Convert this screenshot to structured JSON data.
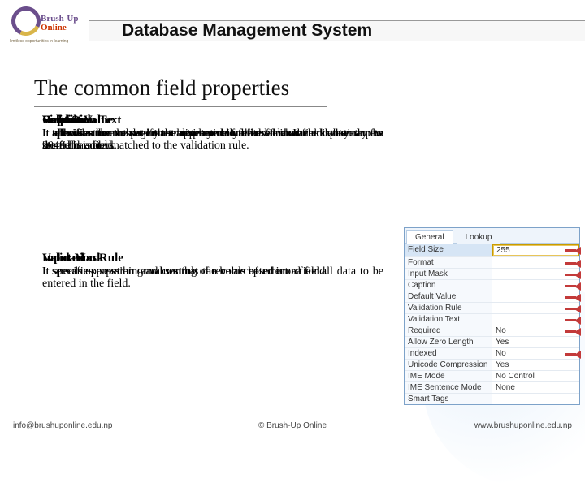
{
  "brand": {
    "name_a": "Brush",
    "name_hy": "-",
    "name_b": "Up",
    "sub": "Online",
    "tag": "limitless opportunities in learning"
  },
  "title": "Database Management System",
  "subtitle": "The common field properties",
  "group1": [
    {
      "h": "Field Size",
      "b": "It allows a user to set the maximum number of characters that can be stored in a field."
    },
    {
      "h": "Caption",
      "b": "It allows a user to set an alternate name for the field. It can contain up to 2048 characters."
    },
    {
      "h": "Validation Text",
      "b": "It specifies the message to be displayed to the user when the data entry for the field is not matched to the validation rule."
    },
    {
      "h": "Format",
      "b": "It allows a user to specify the appearance of the value when displayed."
    },
    {
      "h": "Default Value",
      "b": "It specifies the value that is automatically entered in a field when a new record is added."
    },
    {
      "h": "Required",
      "b": "It tells whether the data must be entered in a field or not."
    }
  ],
  "group2": [
    {
      "h": "Input Mask",
      "b": "It specifies a pattern and controls the value of a record for all data to be entered in the field."
    },
    {
      "h": "Validation Rule",
      "b": "It sets an expression or values that can be accepted into a field."
    },
    {
      "h": "Indexed",
      "b": "It speeds up searching and sorting of records based on a field."
    }
  ],
  "panel": {
    "tab_active": "General",
    "tab_inactive": "Lookup",
    "arrow_rows": [
      "Field Size",
      "Format",
      "Input Mask",
      "Caption",
      "Default Value",
      "Validation Rule",
      "Validation Text",
      "Required",
      "Indexed"
    ],
    "rows": [
      {
        "k": "Field Size",
        "v": "255"
      },
      {
        "k": "Format",
        "v": ""
      },
      {
        "k": "Input Mask",
        "v": ""
      },
      {
        "k": "Caption",
        "v": ""
      },
      {
        "k": "Default Value",
        "v": ""
      },
      {
        "k": "Validation Rule",
        "v": ""
      },
      {
        "k": "Validation Text",
        "v": ""
      },
      {
        "k": "Required",
        "v": "No"
      },
      {
        "k": "Allow Zero Length",
        "v": "Yes"
      },
      {
        "k": "Indexed",
        "v": "No"
      },
      {
        "k": "Unicode Compression",
        "v": "Yes"
      },
      {
        "k": "IME Mode",
        "v": "No Control"
      },
      {
        "k": "IME Sentence Mode",
        "v": "None"
      },
      {
        "k": "Smart Tags",
        "v": ""
      }
    ]
  },
  "footer": {
    "left": "info@brushuponline.edu.np",
    "center": "© Brush-Up Online",
    "right": "www.brushuponline.edu.np"
  }
}
